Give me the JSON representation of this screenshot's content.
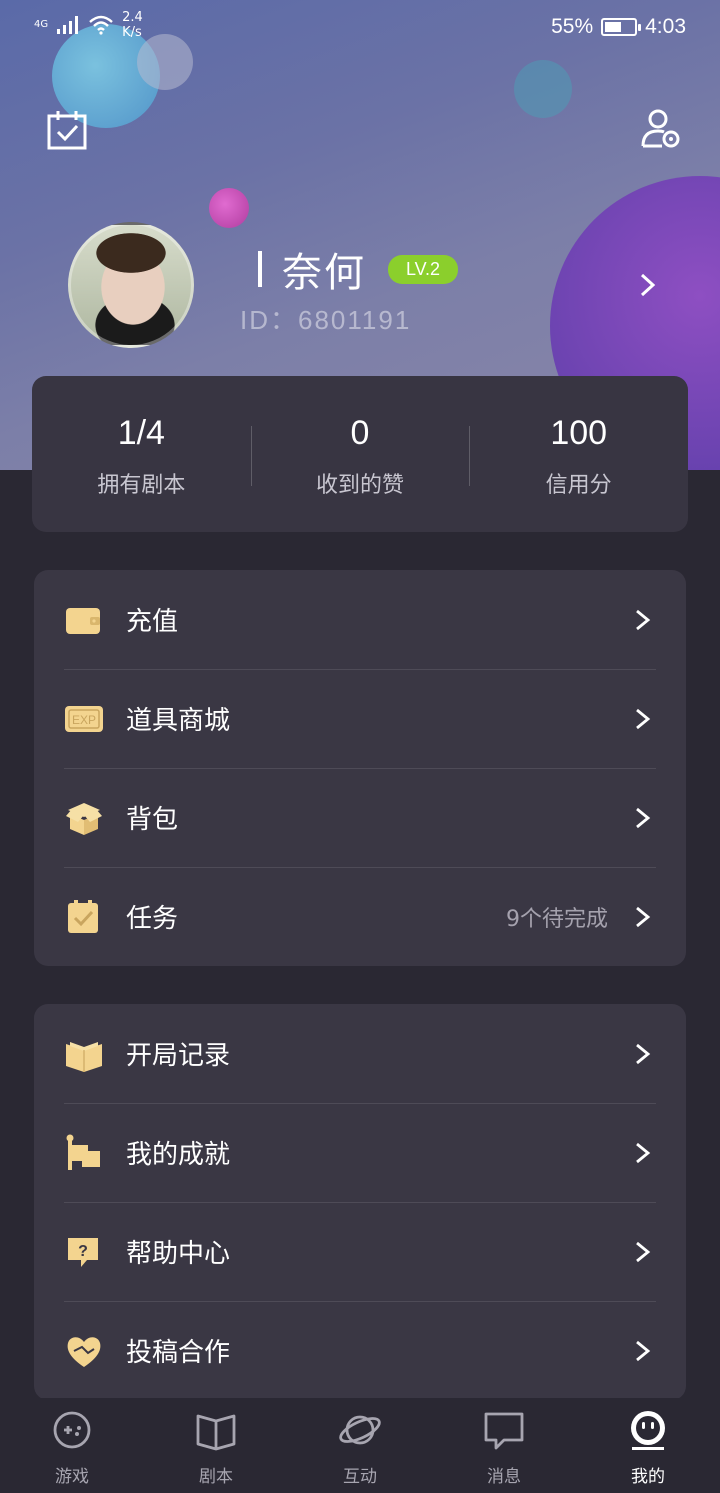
{
  "status_bar": {
    "network": "4G",
    "speed_value": "2.4",
    "speed_unit": "K/s",
    "battery_text": "55%",
    "battery_level": 0.55,
    "time": "4:03"
  },
  "header": {
    "calendar_icon": "calendar-check-icon",
    "settings_icon": "user-settings-icon"
  },
  "profile": {
    "name": "奈何",
    "level": "LV.2",
    "id_text": "ID：6801191",
    "level_color": "#8bcf2c"
  },
  "stats": [
    {
      "value": "1/4",
      "label": "拥有剧本"
    },
    {
      "value": "0",
      "label": "收到的赞"
    },
    {
      "value": "100",
      "label": "信用分"
    }
  ],
  "menu_group_1": [
    {
      "label": "充值",
      "icon": "wallet-icon"
    },
    {
      "label": "道具商城",
      "icon": "exp-ticket-icon"
    },
    {
      "label": "背包",
      "icon": "open-box-icon"
    },
    {
      "label": "任务",
      "icon": "task-check-icon",
      "extra": "9个待完成"
    }
  ],
  "menu_group_2": [
    {
      "label": "开局记录",
      "icon": "open-book-icon"
    },
    {
      "label": "我的成就",
      "icon": "flag-icon"
    },
    {
      "label": "帮助中心",
      "icon": "help-bubble-icon"
    },
    {
      "label": "投稿合作",
      "icon": "handshake-heart-icon"
    }
  ],
  "bottom_nav": [
    {
      "label": "游戏",
      "icon": "gamepad-icon",
      "active": false
    },
    {
      "label": "剧本",
      "icon": "book-icon",
      "active": false
    },
    {
      "label": "互动",
      "icon": "planet-icon",
      "active": false
    },
    {
      "label": "消息",
      "icon": "chat-icon",
      "active": false
    },
    {
      "label": "我的",
      "icon": "face-icon",
      "active": true
    }
  ],
  "colors": {
    "accent_gold": "#f3d48f",
    "card_bg": "#3a3744",
    "page_bg": "#2a2833"
  }
}
